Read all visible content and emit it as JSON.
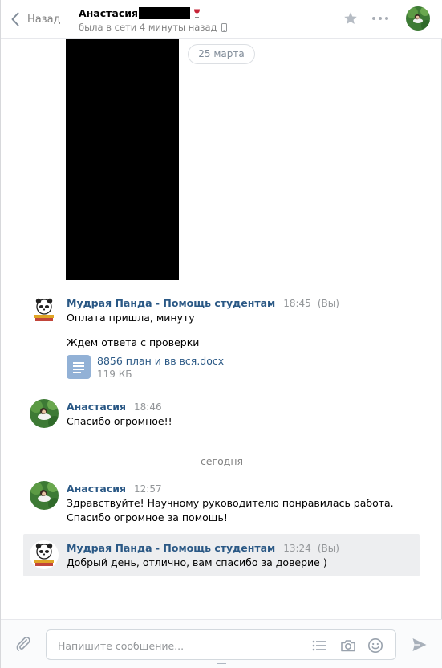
{
  "header": {
    "back_label": "Назад",
    "peer_name": "Анастасия",
    "peer_status": "была в сети 4 минуты назад"
  },
  "chat": {
    "date_pill": "25 марта",
    "today_label": "сегодня",
    "messages": [
      {
        "author": "Мудрая Панда - Помощь студентам",
        "time": "18:45",
        "you_label": "(Вы)",
        "lines": [
          "Оплата пришла, минуту",
          "Ждем ответа с проверки"
        ],
        "attachment": {
          "name": "8856 план и вв вся.docx",
          "size": "119 КБ"
        }
      },
      {
        "author": "Анастасия",
        "time": "18:46",
        "lines": [
          "Спасибо огромное!!"
        ]
      },
      {
        "author": "Анастасия",
        "time": "12:57",
        "lines": [
          "Здравствуйте! Научному руководителю понравилась работа.",
          "Спасибо огромное за помощь!"
        ]
      },
      {
        "author": "Мудрая Панда - Помощь студентам",
        "time": "13:24",
        "you_label": "(Вы)",
        "lines": [
          "Добрый день, отлично, вам спасибо за доверие )"
        ]
      }
    ]
  },
  "composer": {
    "value": "",
    "placeholder": "Напишите сообщение..."
  },
  "colors": {
    "link": "#2a5885",
    "muted": "#828282",
    "doc_icon": "#92b1d6",
    "selected_row": "#edeef0"
  },
  "icons": [
    "chevron-left-icon",
    "wine-glass-icon",
    "phone-icon",
    "star-icon",
    "more-icon",
    "paperclip-icon",
    "list-icon",
    "camera-icon",
    "smile-icon",
    "send-icon",
    "document-icon"
  ]
}
